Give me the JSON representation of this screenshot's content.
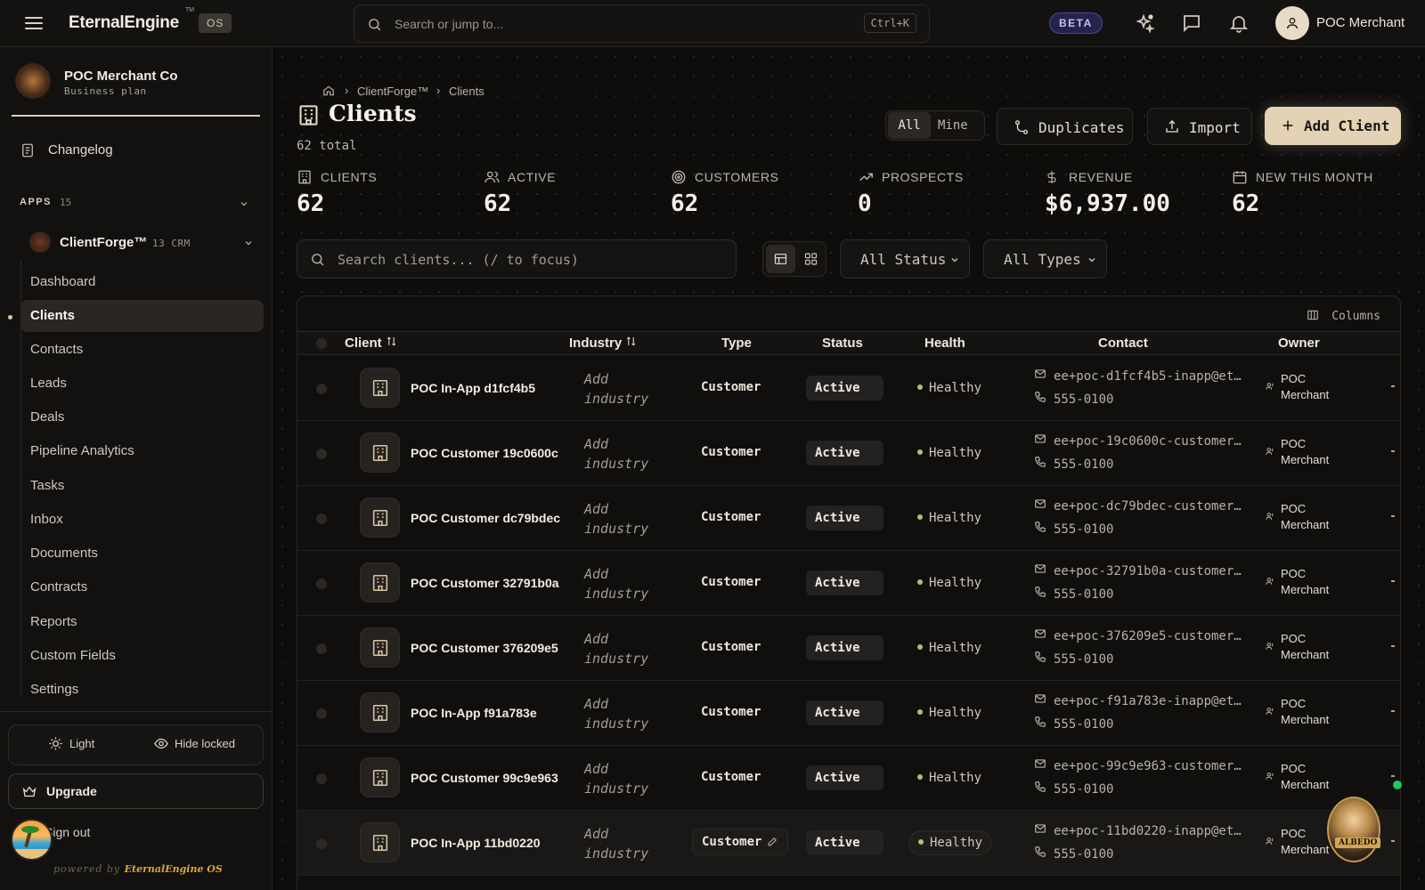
{
  "topbar": {
    "brand": "EternalEngine",
    "brand_tm": "TM",
    "brand_os": "OS",
    "search_placeholder": "Search or jump to...",
    "search_shortcut": "Ctrl+K",
    "beta_label": "BETA",
    "user_name": "POC Merchant"
  },
  "sidebar": {
    "org_name": "POC Merchant Co",
    "org_plan": "Business plan",
    "changelog_label": "Changelog",
    "apps_label": "APPS",
    "apps_count": "15",
    "app_name": "ClientForge™",
    "app_sub": "13 CRM",
    "items": [
      {
        "label": "Dashboard"
      },
      {
        "label": "Clients"
      },
      {
        "label": "Contacts"
      },
      {
        "label": "Leads"
      },
      {
        "label": "Deals"
      },
      {
        "label": "Pipeline Analytics"
      },
      {
        "label": "Tasks"
      },
      {
        "label": "Inbox"
      },
      {
        "label": "Documents"
      },
      {
        "label": "Contracts"
      },
      {
        "label": "Reports"
      },
      {
        "label": "Custom Fields"
      },
      {
        "label": "Settings"
      }
    ],
    "active_item": "Clients",
    "light_label": "Light",
    "hide_locked_label": "Hide locked",
    "upgrade_label": "Upgrade",
    "signout_label": "Sign out",
    "powered_prefix": "powered by",
    "powered_brand": "EternalEngine OS"
  },
  "main": {
    "breadcrumb": {
      "app": "ClientForge™",
      "current": "Clients"
    },
    "title": "Clients",
    "total": "62 total",
    "filter_all": "All",
    "filter_mine": "Mine",
    "duplicates_label": "Duplicates",
    "import_label": "Import",
    "add_client_label": "Add Client",
    "stats": [
      {
        "label": "CLIENTS",
        "value": "62",
        "icon": "building-icon"
      },
      {
        "label": "ACTIVE",
        "value": "62",
        "icon": "users-icon"
      },
      {
        "label": "CUSTOMERS",
        "value": "62",
        "icon": "target-icon"
      },
      {
        "label": "PROSPECTS",
        "value": "0",
        "icon": "trending-up-icon"
      },
      {
        "label": "REVENUE",
        "value": "$6,937.00",
        "icon": "dollar-icon"
      },
      {
        "label": "NEW THIS MONTH",
        "value": "62",
        "icon": "calendar-icon"
      }
    ],
    "client_search_placeholder": "Search clients... (/ to focus)",
    "status_filter": "All Status",
    "type_filter": "All Types",
    "columns_label": "Columns",
    "headers": {
      "client": "Client",
      "industry": "Industry",
      "type": "Type",
      "status": "Status",
      "health": "Health",
      "contact": "Contact",
      "owner": "Owner"
    },
    "rows": [
      {
        "name": "POC In-App d1fcf4b5",
        "industry": "Add industry",
        "type": "Customer",
        "status": "Active",
        "health": "Healthy",
        "email": "ee+poc-d1fcf4b5-inapp@et…",
        "phone": "555-0100",
        "owner_first": "POC",
        "owner_last": "Merchant"
      },
      {
        "name": "POC Customer 19c0600c",
        "industry": "Add industry",
        "type": "Customer",
        "status": "Active",
        "health": "Healthy",
        "email": "ee+poc-19c0600c-customer…",
        "phone": "555-0100",
        "owner_first": "POC",
        "owner_last": "Merchant"
      },
      {
        "name": "POC Customer dc79bdec",
        "industry": "Add industry",
        "type": "Customer",
        "status": "Active",
        "health": "Healthy",
        "email": "ee+poc-dc79bdec-customer…",
        "phone": "555-0100",
        "owner_first": "POC",
        "owner_last": "Merchant"
      },
      {
        "name": "POC Customer 32791b0a",
        "industry": "Add industry",
        "type": "Customer",
        "status": "Active",
        "health": "Healthy",
        "email": "ee+poc-32791b0a-customer…",
        "phone": "555-0100",
        "owner_first": "POC",
        "owner_last": "Merchant"
      },
      {
        "name": "POC Customer 376209e5",
        "industry": "Add industry",
        "type": "Customer",
        "status": "Active",
        "health": "Healthy",
        "email": "ee+poc-376209e5-customer…",
        "phone": "555-0100",
        "owner_first": "POC",
        "owner_last": "Merchant"
      },
      {
        "name": "POC In-App f91a783e",
        "industry": "Add industry",
        "type": "Customer",
        "status": "Active",
        "health": "Healthy",
        "email": "ee+poc-f91a783e-inapp@et…",
        "phone": "555-0100",
        "owner_first": "POC",
        "owner_last": "Merchant"
      },
      {
        "name": "POC Customer 99c9e963",
        "industry": "Add industry",
        "type": "Customer",
        "status": "Active",
        "health": "Healthy",
        "email": "ee+poc-99c9e963-customer…",
        "phone": "555-0100",
        "owner_first": "POC",
        "owner_last": "Merchant"
      },
      {
        "name": "POC In-App 11bd0220",
        "industry": "Add industry",
        "type": "Customer",
        "status": "Active",
        "health": "Healthy",
        "email": "ee+poc-11bd0220-inapp@et…",
        "phone": "555-0100",
        "owner_first": "POC",
        "owner_last": "Merchant"
      }
    ]
  },
  "widget": {
    "label": "ALBEDO"
  },
  "colors": {
    "accent": "#e3d2b5",
    "beta": "#c2c0f5",
    "online": "#22c55e",
    "health_dot": "#a8c47a"
  }
}
